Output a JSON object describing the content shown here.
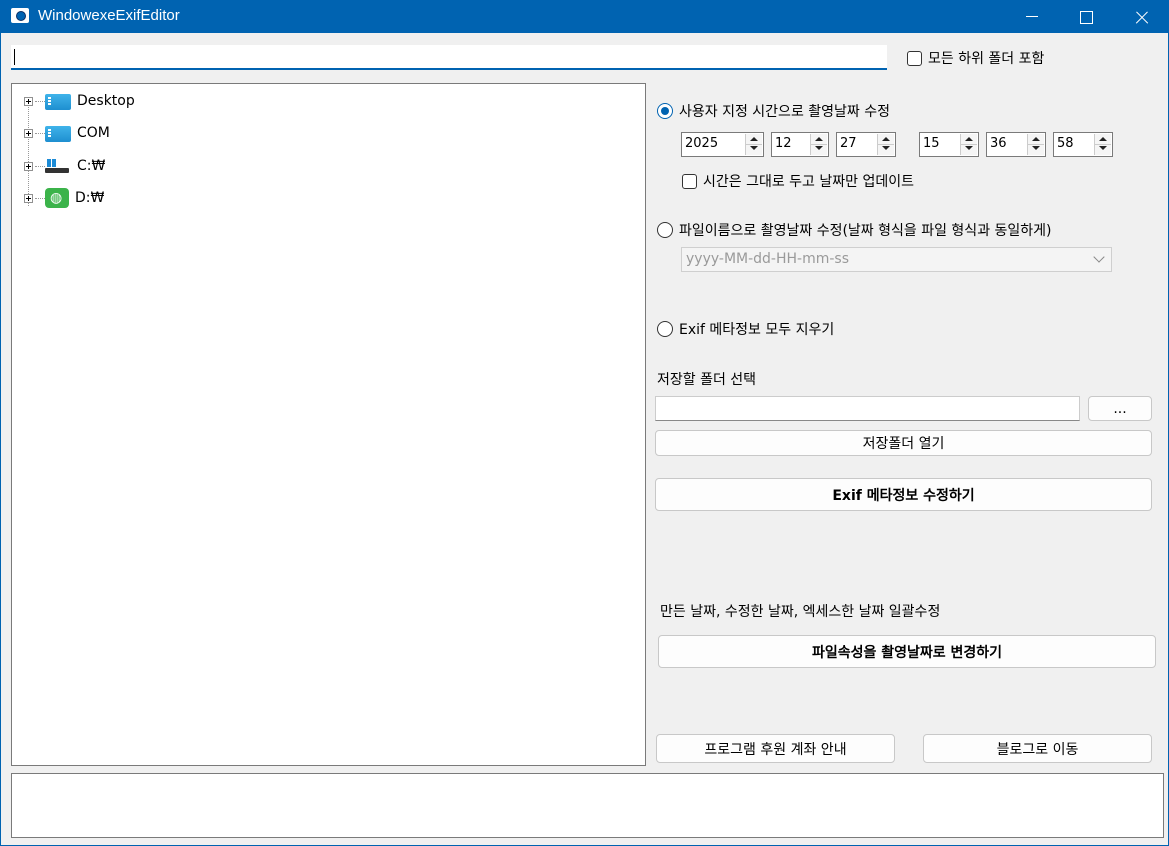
{
  "window": {
    "title": "WindowexeExifEditor",
    "accent": "#0063b1"
  },
  "path_input": {
    "value": ""
  },
  "include_subfolders": {
    "label": "모든 하위 폴더 포함",
    "checked": false
  },
  "tree": {
    "items": [
      {
        "label": "Desktop",
        "icon": "desktop-icon"
      },
      {
        "label": "COM",
        "icon": "computer-icon"
      },
      {
        "label": "C:₩",
        "icon": "system-drive-icon"
      },
      {
        "label": "D:₩",
        "icon": "network-drive-icon"
      }
    ]
  },
  "options": {
    "custom_time": {
      "label": "사용자 지정 시간으로 촬영날짜 수정",
      "selected": true,
      "year": "2025",
      "month": "12",
      "day": "27",
      "hour": "15",
      "minute": "36",
      "second": "58",
      "date_only_label": "시간은 그대로 두고 날짜만 업데이트",
      "date_only_checked": false
    },
    "filename": {
      "label": "파일이름으로 촬영날짜 수정(날짜 형식을 파일 형식과 동일하게)",
      "selected": false,
      "format_value": "yyyy-MM-dd-HH-mm-ss"
    },
    "clear_exif": {
      "label": "Exif 메타정보 모두 지우기",
      "selected": false
    }
  },
  "save": {
    "folder_label": "저장할 폴더 선택",
    "folder_value": "",
    "browse_label": "...",
    "open_folder_label": "저장폴더 열기",
    "apply_label": "Exif 메타정보 수정하기"
  },
  "file_dates": {
    "label": "만든 날짜, 수정한 날짜, 엑세스한 날짜 일괄수정",
    "apply_label": "파일속성을 촬영날짜로 변경하기"
  },
  "footer": {
    "support_label": "프로그램 후원 계좌 안내",
    "blog_label": "블로그로 이동"
  }
}
